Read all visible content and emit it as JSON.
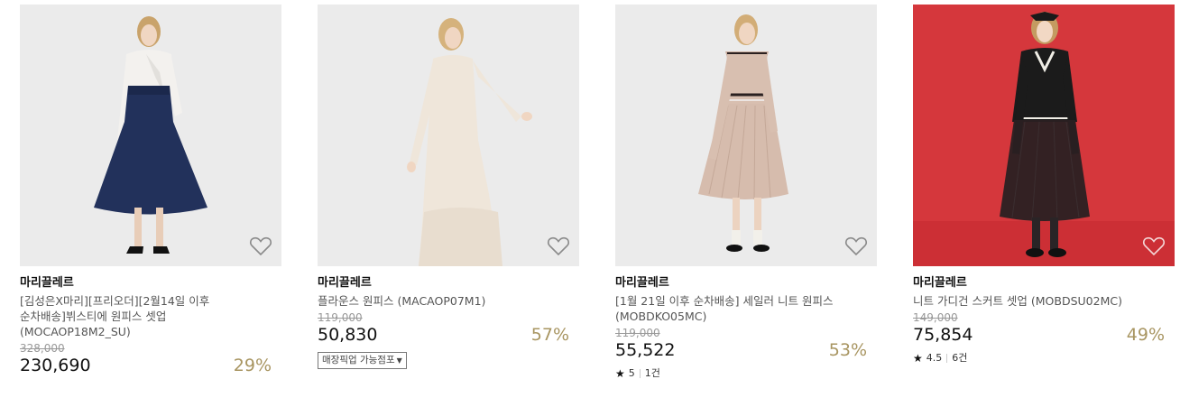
{
  "products": [
    {
      "brand": "마리끌레르",
      "name": "[김성은X마리][프리오더][2월14일 이후 순차배송]뷔스티에 원피스 셋업 (MOCAOP18M2_SU)",
      "original_price": "328,000",
      "sale_price": "230,690",
      "discount": "29%",
      "wishlist_icon": "heart-outline-icon",
      "image_desc": "navy bustier dress with white blouse"
    },
    {
      "brand": "마리끌레르",
      "name": "플라운스 원피스 (MACAOP07M1)",
      "original_price": "119,000",
      "sale_price": "50,830",
      "discount": "57%",
      "pickup_label": "매장픽업 가능점포",
      "wishlist_icon": "heart-outline-icon"
    },
    {
      "brand": "마리끌레르",
      "name": "[1월 21일 이후 순차배송] 세일러 니트 원피스 (MOBDKO05MC)",
      "original_price": "119,000",
      "sale_price": "55,522",
      "discount": "53%",
      "rating": "5",
      "review_count": "1건",
      "wishlist_icon": "heart-outline-icon"
    },
    {
      "brand": "마리끌레르",
      "name": "니트 가디건 스커트 셋업 (MOBDSU02MC)",
      "original_price": "149,000",
      "sale_price": "75,854",
      "discount": "49%",
      "rating": "4.5",
      "review_count": "6건",
      "wishlist_icon": "heart-outline-icon"
    }
  ],
  "colors": {
    "discount": "#a89561",
    "thumb_red": "#d5373c",
    "thumb_grey": "#ececec"
  }
}
